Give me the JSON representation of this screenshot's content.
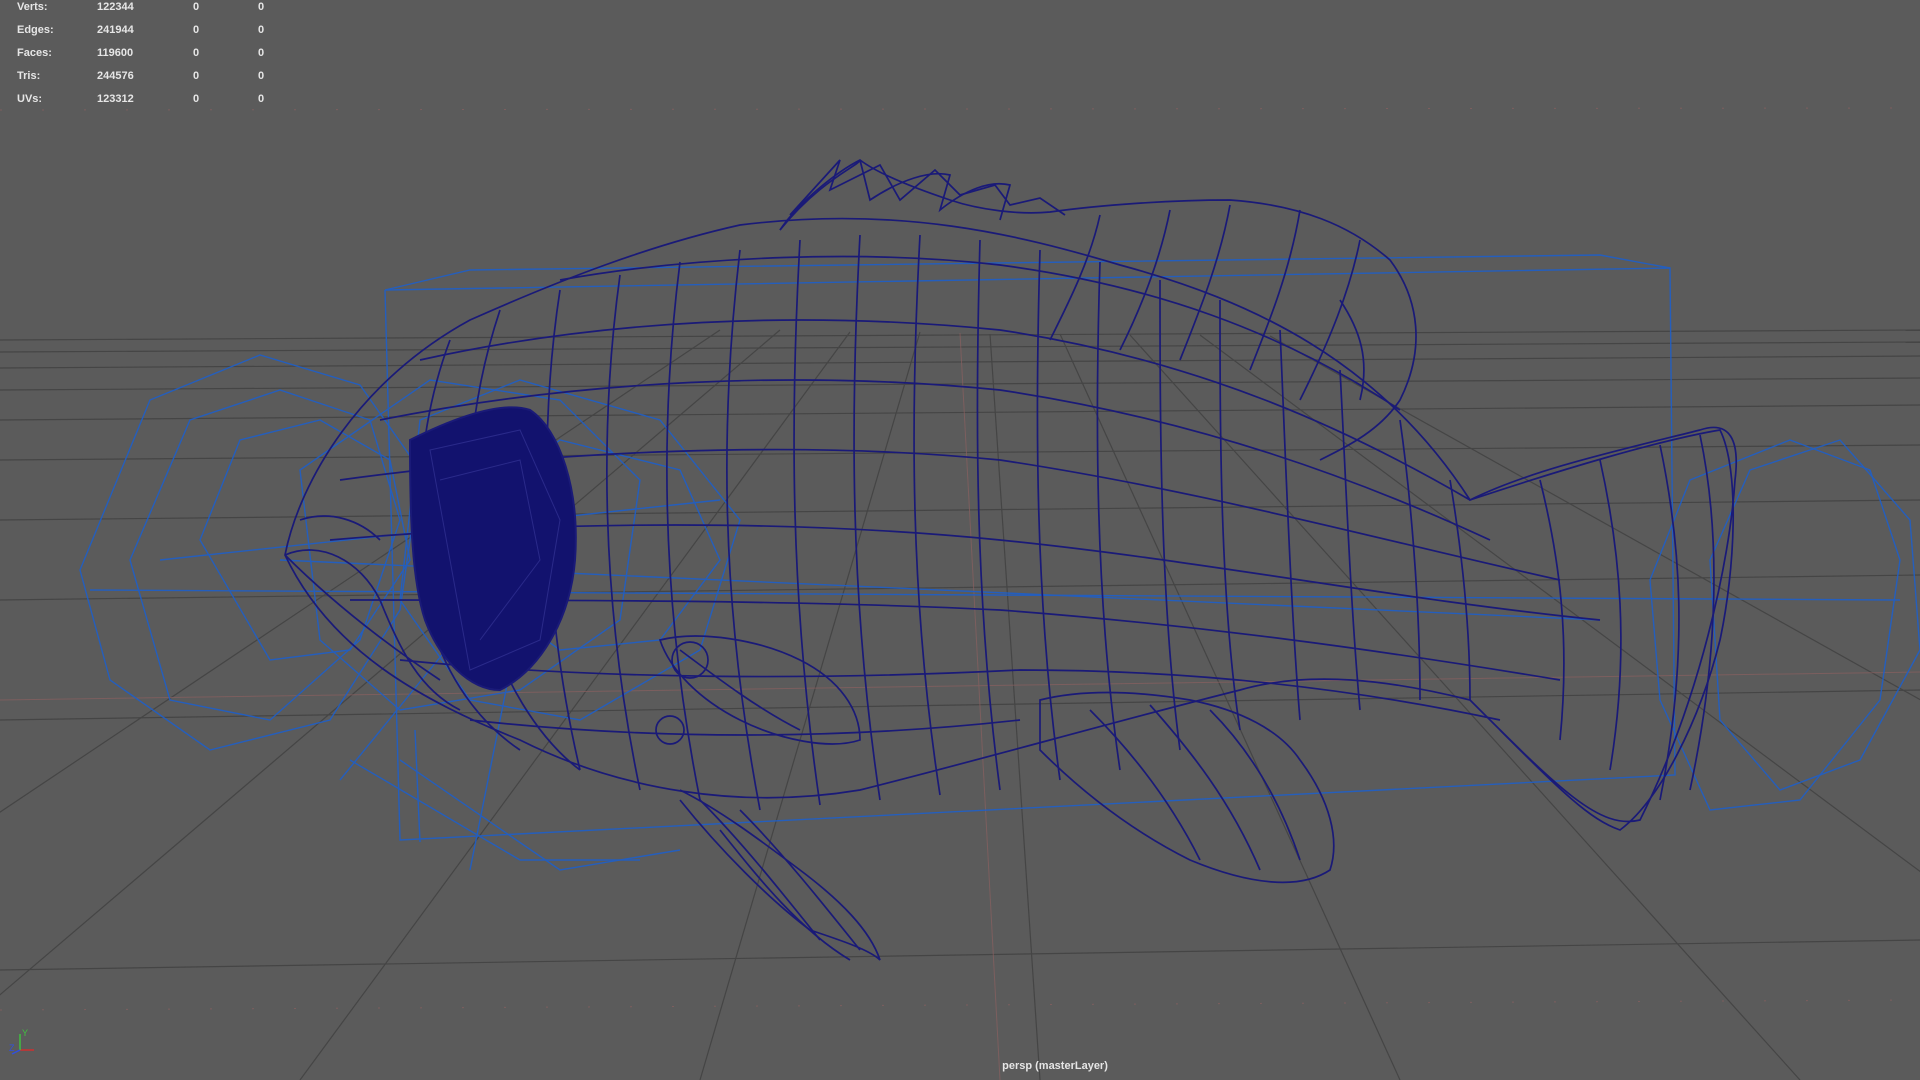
{
  "viewport": {
    "background": "#5b5b5b",
    "camera_label": "persp (masterLayer)"
  },
  "stats": {
    "rows": [
      {
        "label": "Verts:",
        "v1": "122344",
        "v2": "0",
        "v3": "0"
      },
      {
        "label": "Edges:",
        "v1": "241944",
        "v2": "0",
        "v3": "0"
      },
      {
        "label": "Faces:",
        "v1": "119600",
        "v2": "0",
        "v3": "0"
      },
      {
        "label": "Tris:",
        "v1": "244576",
        "v2": "0",
        "v3": "0"
      },
      {
        "label": "UVs:",
        "v1": "123312",
        "v2": "0",
        "v3": "0"
      }
    ]
  },
  "axis": {
    "y_label": "Y",
    "z_label": "Z",
    "x_color": "#d03030",
    "y_color": "#40c040",
    "z_color": "#3050e0"
  },
  "colors": {
    "grid": "#454545",
    "grid_axis": "#9a6a6a",
    "mesh_wire": "#1a1a78",
    "eye_fill": "#12126e",
    "helper_wire": "#1f5fc8"
  },
  "icons": {
    "axis_gizmo": "xyz-axis-gizmo-icon"
  }
}
